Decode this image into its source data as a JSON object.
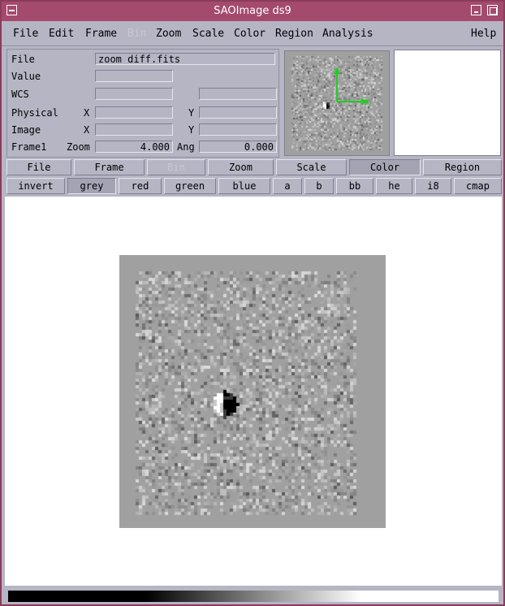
{
  "window": {
    "title": "SAOImage ds9"
  },
  "menubar": {
    "items": [
      {
        "label": "File",
        "disabled": false
      },
      {
        "label": "Edit",
        "disabled": false
      },
      {
        "label": "Frame",
        "disabled": false
      },
      {
        "label": "Bin",
        "disabled": true
      },
      {
        "label": "Zoom",
        "disabled": false
      },
      {
        "label": "Scale",
        "disabled": false
      },
      {
        "label": "Color",
        "disabled": false
      },
      {
        "label": "Region",
        "disabled": false
      },
      {
        "label": "Analysis",
        "disabled": false
      },
      {
        "label": "Help",
        "disabled": false
      }
    ]
  },
  "info": {
    "file_label": "File",
    "file_value": "zoom_diff.fits",
    "value_label": "Value",
    "value_value": "",
    "wcs_label": "WCS",
    "wcs_value1": "",
    "wcs_value2": "",
    "physical_label": "Physical",
    "physical_x_label": "X",
    "physical_x": "",
    "physical_y_label": "Y",
    "physical_y": "",
    "image_label": "Image",
    "image_x_label": "X",
    "image_x": "",
    "image_y_label": "Y",
    "image_y": "",
    "frame_label": "Frame1",
    "zoom_label": "Zoom",
    "zoom_value": "4.000",
    "ang_label": "Ang",
    "ang_value": "0.000"
  },
  "panner": {
    "compass_y": "Y",
    "compass_x": "X",
    "compass_color": "#22cc22"
  },
  "buttonbar": {
    "items": [
      {
        "label": "File",
        "active": false,
        "disabled": false
      },
      {
        "label": "Frame",
        "active": false,
        "disabled": false
      },
      {
        "label": "Bin",
        "active": false,
        "disabled": true
      },
      {
        "label": "Zoom",
        "active": false,
        "disabled": false
      },
      {
        "label": "Scale",
        "active": false,
        "disabled": false
      },
      {
        "label": "Color",
        "active": true,
        "disabled": false
      },
      {
        "label": "Region",
        "active": false,
        "disabled": false
      }
    ]
  },
  "colormaps": {
    "items": [
      {
        "label": "invert",
        "active": false
      },
      {
        "label": "grey",
        "active": true
      },
      {
        "label": "red",
        "active": false
      },
      {
        "label": "green",
        "active": false
      },
      {
        "label": "blue",
        "active": false
      },
      {
        "label": "a",
        "active": false
      },
      {
        "label": "b",
        "active": false
      },
      {
        "label": "bb",
        "active": false
      },
      {
        "label": "he",
        "active": false
      },
      {
        "label": "i8",
        "active": false
      },
      {
        "label": "cmap",
        "active": false
      }
    ]
  },
  "colors": {
    "titlebar": "#a44a6c",
    "chrome": "#b5b5c4",
    "image_bg": "#a0a0a0"
  }
}
